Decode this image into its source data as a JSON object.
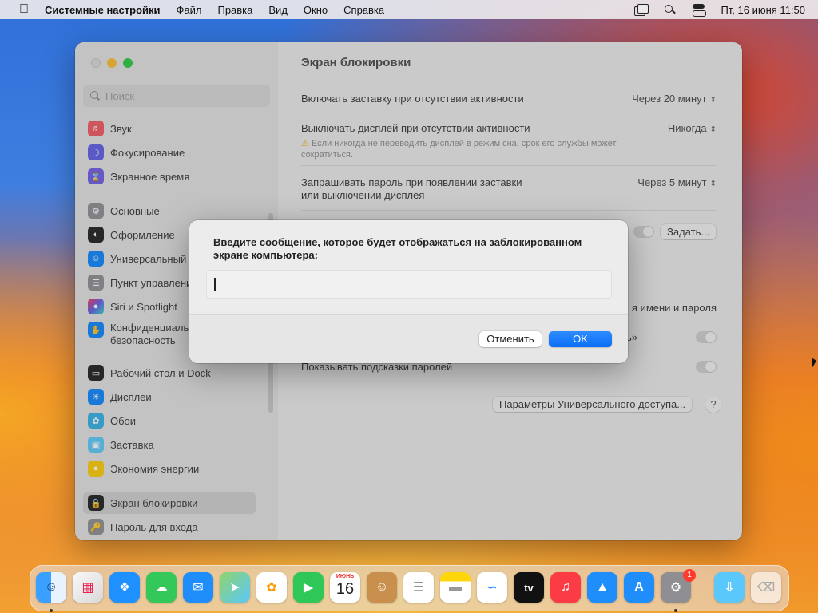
{
  "menubar": {
    "apple": "",
    "app_name": "Системные настройки",
    "menus": [
      "Файл",
      "Правка",
      "Вид",
      "Окно",
      "Справка"
    ],
    "clock": "Пт, 16 июня  11:50"
  },
  "window": {
    "search_placeholder": "Поиск",
    "sidebar": {
      "group1": [
        "Звук",
        "Фокусирование",
        "Экранное время"
      ],
      "group2": [
        "Основные",
        "Оформление",
        "Универсальный доступ",
        "Пункт управления",
        "Siri и Spotlight",
        "Конфиденциальность и безопасность"
      ],
      "group2_conf_line1": "Конфиденциальн",
      "group2_conf_line2": "безопасность",
      "group3": [
        "Рабочий стол и Dock",
        "Дисплеи",
        "Обои",
        "Заставка",
        "Экономия энергии"
      ],
      "group4": [
        "Экран блокировки",
        "Пароль для входа"
      ],
      "selected": "Экран блокировки"
    },
    "main": {
      "title": "Экран блокировки",
      "screensaver_label": "Включать заставку при отсутствии активности",
      "screensaver_value": "Через 20 минут",
      "display_off_label": "Выключать дисплей при отсутствии активности",
      "display_off_value": "Никогда",
      "display_off_note": "Если никогда не переводить дисплей в режим сна, срок его службы может сократиться.",
      "password_label_line1": "Запрашивать пароль при появлении заставки",
      "password_label_line2": "или выключении дисплея",
      "password_value": "Через 5 минут",
      "set_button": "Задать...",
      "name_password_fragment": "я имени и пароля",
      "quote_fragment": "ь»",
      "hints_label": "Показывать подсказки паролей",
      "accessibility_button": "Параметры Универсального доступа...",
      "help": "?"
    }
  },
  "dialog": {
    "message": "Введите сообщение, которое будет отображаться на заблокированном экране компьютера:",
    "input_value": "",
    "cancel": "Отменить",
    "ok": "OK"
  },
  "dock": {
    "calendar_month": "ИЮНЬ",
    "calendar_day": "16",
    "tv_label": "tv",
    "settings_badge": "1"
  },
  "colors": {
    "accent": "#0a6ef5",
    "traffic_min": "#febc2e",
    "traffic_max": "#28c840",
    "badge": "#ff3b30"
  }
}
